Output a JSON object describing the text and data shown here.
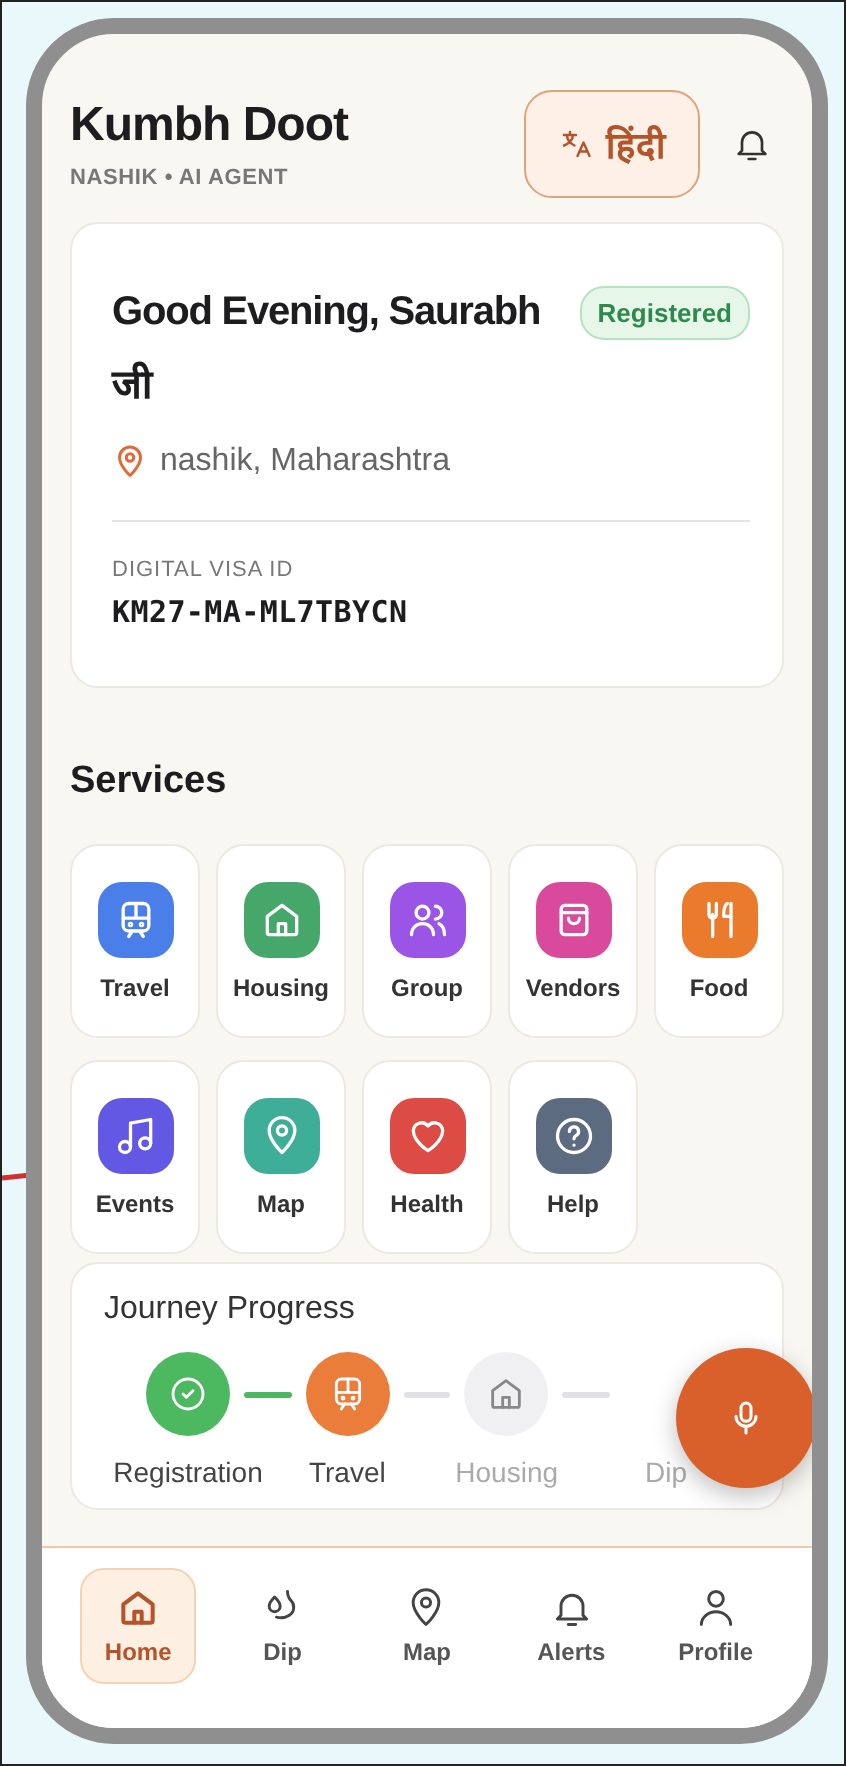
{
  "header": {
    "title": "Kumbh Doot",
    "subtitle": "NASHIK • AI AGENT",
    "language_button": "हिंदी"
  },
  "welcome_card": {
    "greeting": "Good Evening, Saurabh जी",
    "status_badge": "Registered",
    "location": "nashik, Maharashtra",
    "visa_label": "DIGITAL VISA ID",
    "visa_id": "KM27-MA-ML7TBYCN"
  },
  "services": {
    "title": "Services",
    "items": [
      {
        "label": "Travel",
        "color": "#4a7fea"
      },
      {
        "label": "Housing",
        "color": "#45a86a"
      },
      {
        "label": "Group",
        "color": "#9b55e6"
      },
      {
        "label": "Vendors",
        "color": "#d94a9c"
      },
      {
        "label": "Food",
        "color": "#ea7a2c"
      },
      {
        "label": "Events",
        "color": "#6258e3"
      },
      {
        "label": "Map",
        "color": "#3fae98"
      },
      {
        "label": "Health",
        "color": "#dd4b45"
      },
      {
        "label": "Help",
        "color": "#5c6b80"
      }
    ]
  },
  "journey": {
    "title": "Journey Progress",
    "steps": [
      {
        "label": "Registration",
        "kind": "done",
        "covered": false
      },
      {
        "label": "Travel",
        "kind": "current",
        "covered": false
      },
      {
        "label": "Housing",
        "kind": "pending",
        "covered": false
      },
      {
        "label": "Dip",
        "kind": "pending",
        "covered": true
      }
    ]
  },
  "bottom_nav": [
    {
      "label": "Home",
      "selected": true
    },
    {
      "label": "Dip",
      "selected": false
    },
    {
      "label": "Map",
      "selected": false
    },
    {
      "label": "Alerts",
      "selected": false
    },
    {
      "label": "Profile",
      "selected": false
    }
  ]
}
